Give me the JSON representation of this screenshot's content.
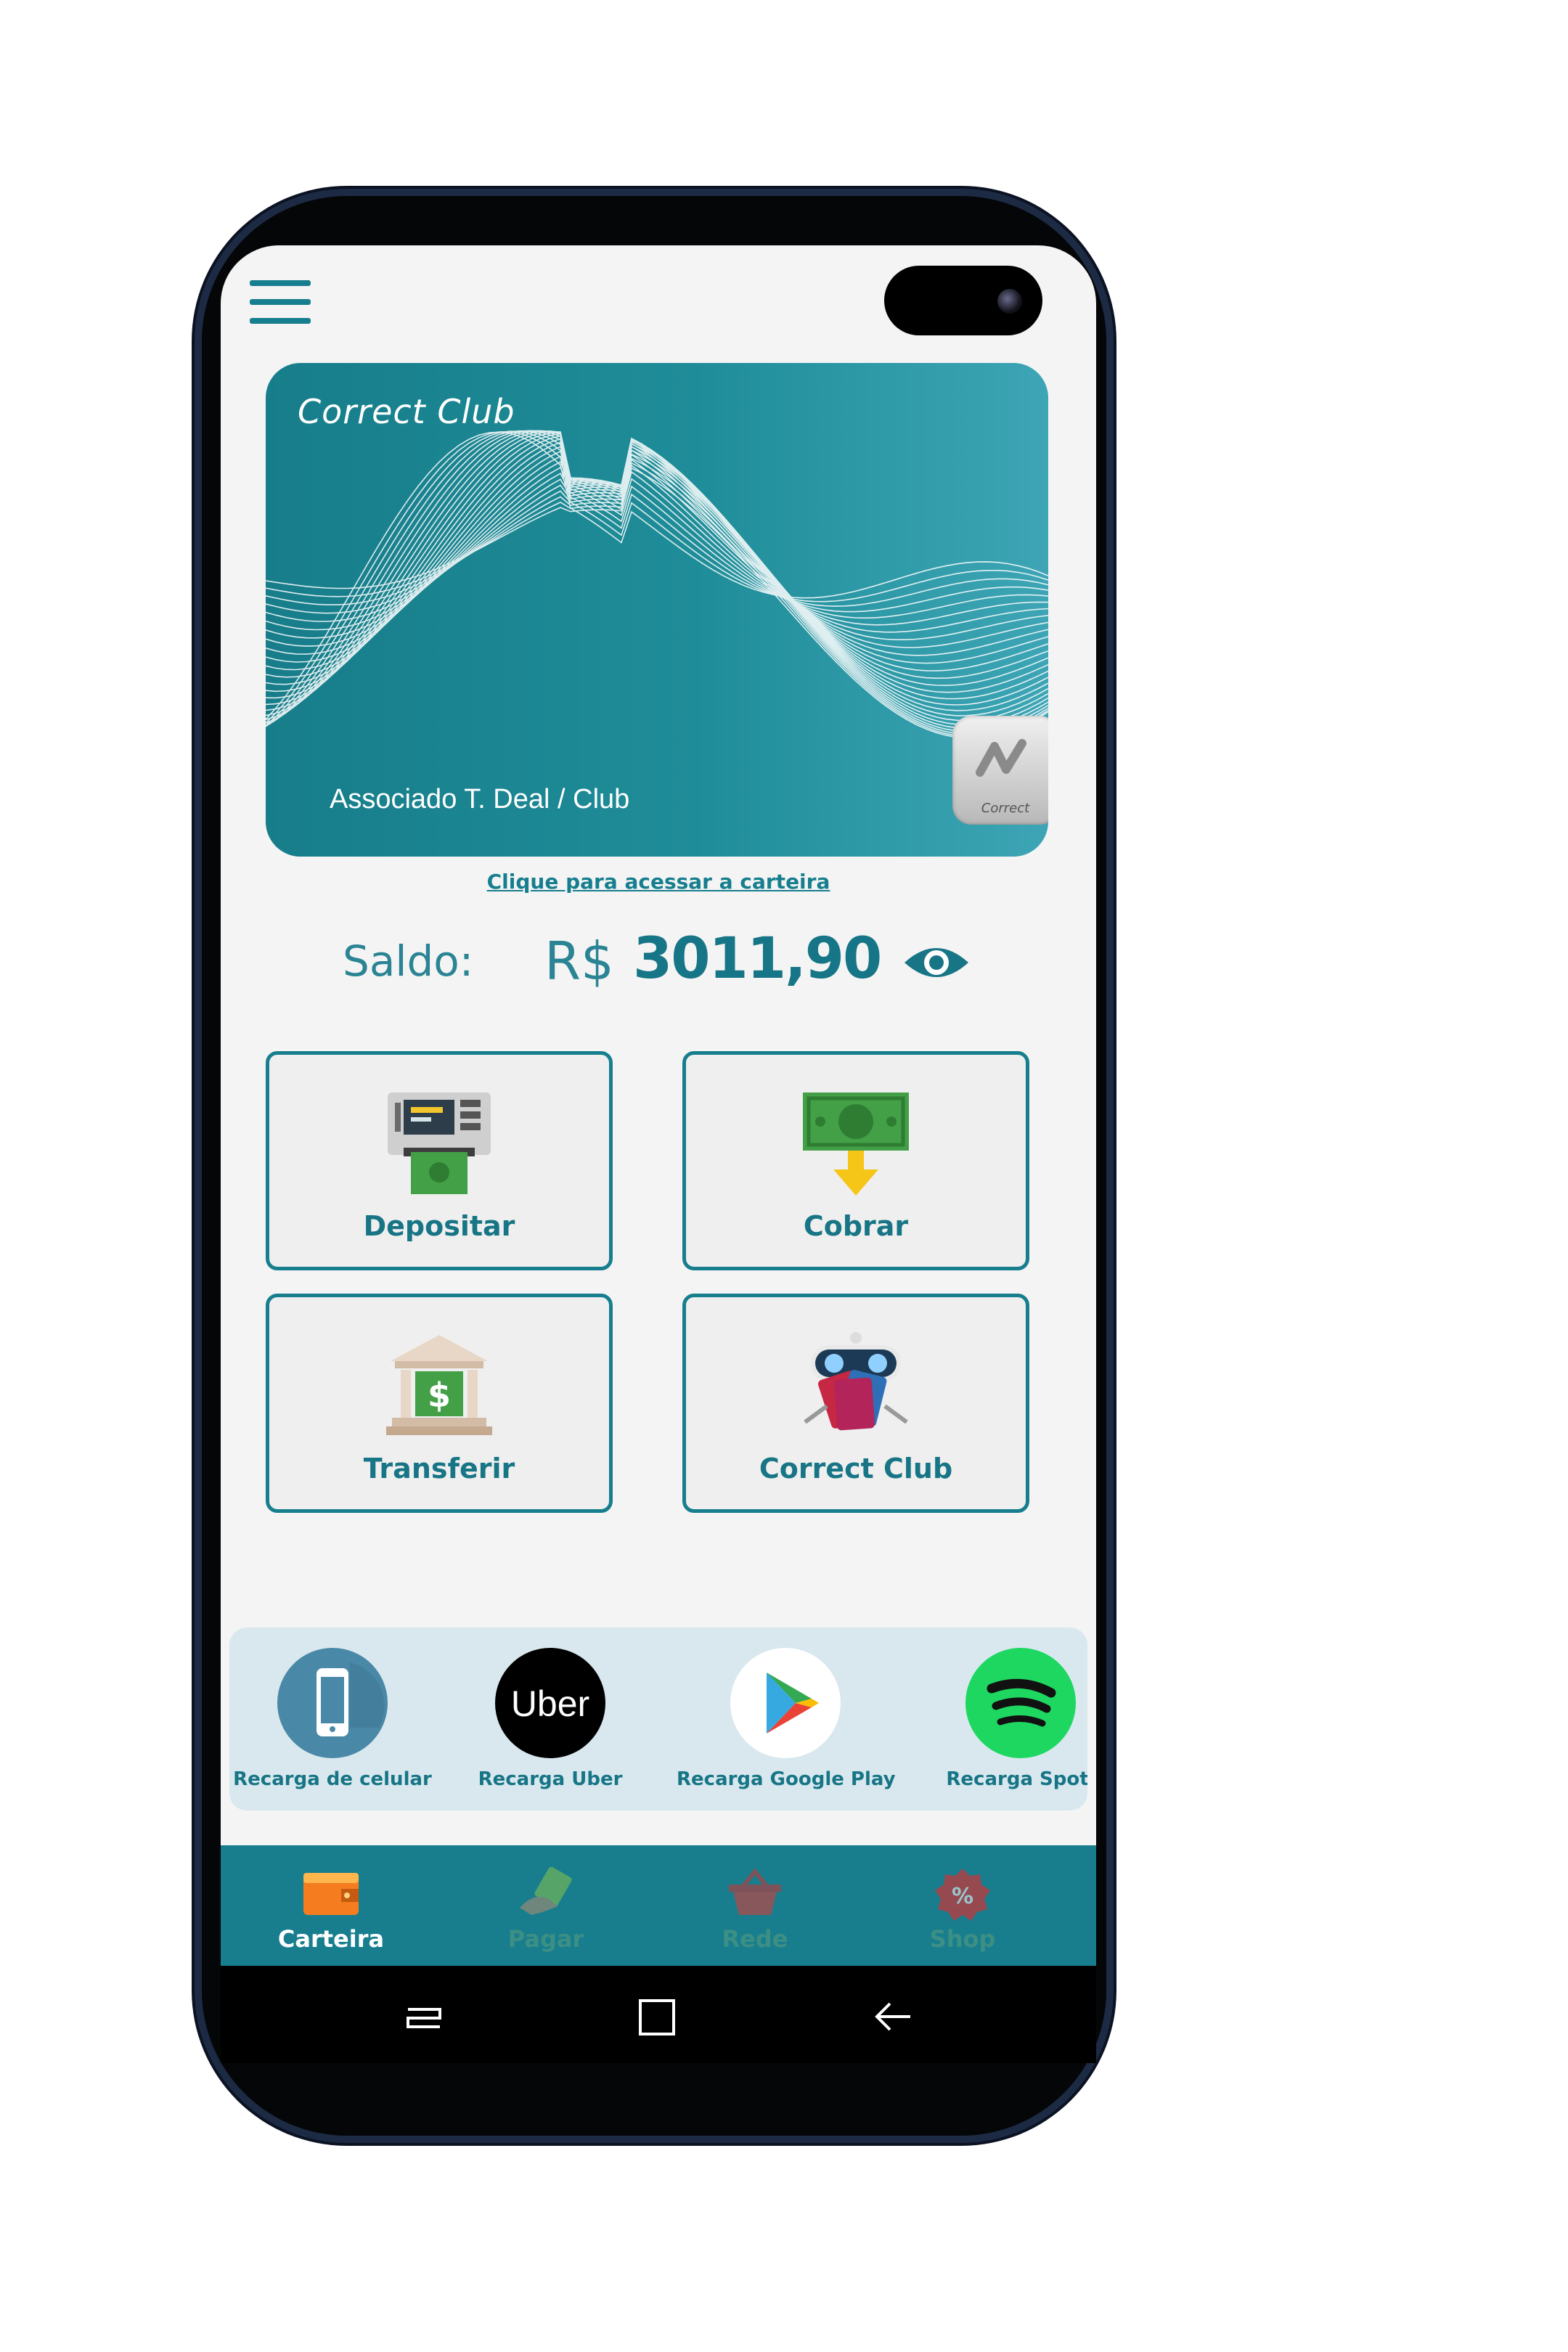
{
  "card": {
    "title": "Correct Club",
    "holder": "Associado T. Deal / Club",
    "logo_text": "Correct"
  },
  "wallet_link": "Clique para acessar a carteira",
  "balance": {
    "label": "Saldo:",
    "currency": "R$",
    "value": "3011,90"
  },
  "actions": [
    {
      "label": "Depositar",
      "icon": "atm-icon"
    },
    {
      "label": "Cobrar",
      "icon": "cash-receive-icon"
    },
    {
      "label": "Transferir",
      "icon": "bank-transfer-icon"
    },
    {
      "label": "Correct Club",
      "icon": "club-cards-icon"
    }
  ],
  "services": [
    {
      "label": "Recarga de celular",
      "icon": "phone-icon"
    },
    {
      "label": "Recarga Uber",
      "icon": "uber-icon",
      "icon_text": "Uber"
    },
    {
      "label": "Recarga Google Play",
      "icon": "google-play-icon"
    },
    {
      "label": "Recarga Spoti",
      "icon": "spotify-icon"
    }
  ],
  "nav": [
    {
      "label": "Carteira",
      "icon": "wallet-icon",
      "active": true
    },
    {
      "label": "Pagar",
      "icon": "pay-icon",
      "active": false
    },
    {
      "label": "Rede",
      "icon": "basket-icon",
      "active": false
    },
    {
      "label": "Shop",
      "icon": "discount-icon",
      "active": false
    }
  ],
  "colors": {
    "primary": "#177e8e",
    "background": "#f4f4f4",
    "services_bg": "#d8e8ee"
  }
}
